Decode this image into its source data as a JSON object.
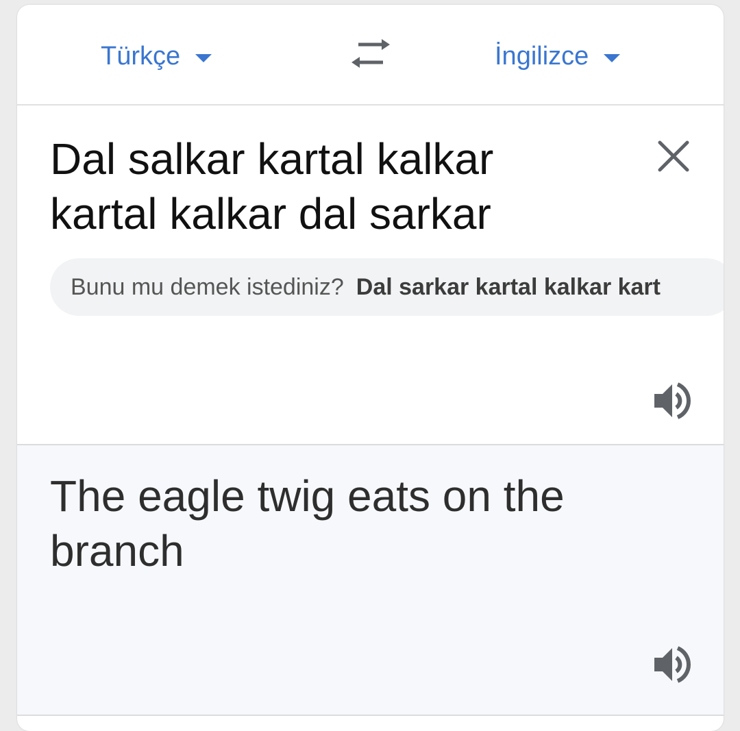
{
  "languages": {
    "source": "Türkçe",
    "target": "İngilizce"
  },
  "input": {
    "text": "Dal salkar kartal kalkar kartal kalkar dal sarkar"
  },
  "suggestion": {
    "prompt": "Bunu mu demek istediniz?",
    "text": "Dal sarkar kartal kalkar kart"
  },
  "output": {
    "text": "The eagle twig eats on the branch"
  },
  "colors": {
    "accent": "#3a76d0",
    "result_bg": "#f6f8fb"
  },
  "icons": {
    "swap": "swap-icon",
    "clear": "close-icon",
    "speaker": "speaker-icon",
    "dropdown": "caret-down-icon"
  }
}
